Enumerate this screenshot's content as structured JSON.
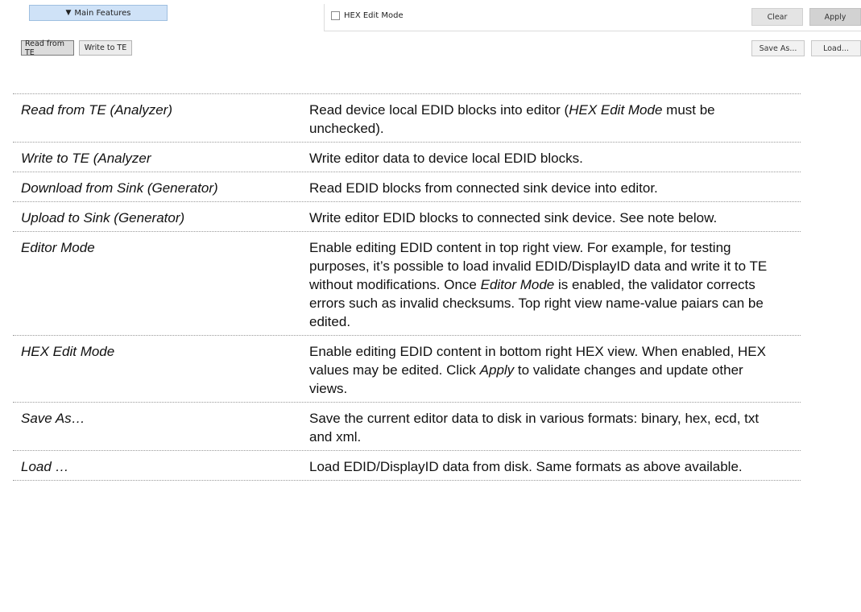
{
  "screenshot": {
    "main_features": {
      "arrow": "▼",
      "label": "Main Features"
    },
    "read_button": "Read from TE",
    "write_button": "Write to TE",
    "hex_edit_label": "HEX Edit Mode",
    "clear_button": "Clear",
    "apply_button": "Apply",
    "save_as_button": "Save As...",
    "load_button": "Load..."
  },
  "rows": [
    {
      "term": "Read from TE (Analyzer)",
      "desc": [
        {
          "t": "Read device local EDID blocks into editor ("
        },
        {
          "t": "HEX Edit Mode",
          "i": true
        },
        {
          "t": " must be unchecked)."
        }
      ]
    },
    {
      "term": "Write to TE (Analyzer",
      "desc": [
        {
          "t": "Write editor data to device local EDID blocks."
        }
      ]
    },
    {
      "term": "Download from Sink (Generator)",
      "desc": [
        {
          "t": "Read EDID blocks from connected sink device into editor."
        }
      ]
    },
    {
      "term": "Upload to Sink (Generator)",
      "desc": [
        {
          "t": "Write editor EDID blocks to connected sink device.  See note below."
        }
      ]
    },
    {
      "term": "Editor Mode",
      "desc": [
        {
          "t": "Enable editing EDID content in top right view. For example, for testing purposes, it’s possible to load invalid EDID/DisplayID data and write it to TE without modifications. Once "
        },
        {
          "t": "Editor Mode",
          "i": true
        },
        {
          "t": " is enabled, the validator corrects errors such as invalid checksums.  Top right view name-value paiars can be edited."
        }
      ]
    },
    {
      "term": "HEX Edit Mode",
      "desc": [
        {
          "t": "Enable editing EDID content in bottom right HEX  view. When enabled, HEX values may be edited. Click "
        },
        {
          "t": "Apply",
          "i": true
        },
        {
          "t": " to validate changes and update other views."
        }
      ]
    },
    {
      "term": "Save As…",
      "desc": [
        {
          "t": "Save the current editor data to disk in various formats: binary, hex, ecd, txt and xml."
        }
      ]
    },
    {
      "term": "Load …",
      "desc": [
        {
          "t": "Load EDID/DisplayID data from disk. Same formats as above available."
        }
      ]
    }
  ]
}
